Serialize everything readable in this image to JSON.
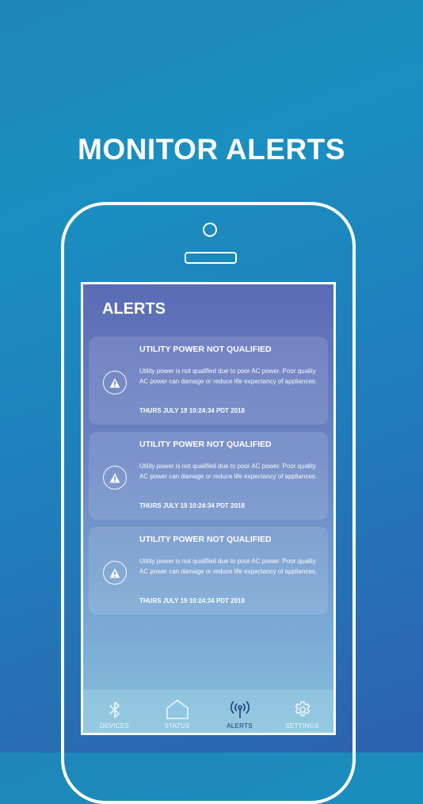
{
  "headline": "MONITOR ALERTS",
  "screen": {
    "title": "ALERTS"
  },
  "alerts": [
    {
      "title": "UTILITY POWER NOT QUALIFIED",
      "body": "Utility power is not qualified due to poor AC power. Poor quality AC power can damage or reduce life expectancy of appliances.",
      "timestamp": "THURS JULY 19 10:24:34 PDT 2018",
      "icon": "warning-icon"
    },
    {
      "title": "UTILITY POWER NOT QUALIFIED",
      "body": "Utility power is not qualified due to poor AC power. Poor quality AC power can damage or reduce life expectancy of appliances.",
      "timestamp": "THURS JULY 19 10:24:34 PDT 2018",
      "icon": "warning-icon"
    },
    {
      "title": "UTILITY POWER NOT QUALIFIED",
      "body": "Utility power is not qualified due to poor AC power. Poor quality AC power can damage or reduce life expectancy of appliances.",
      "timestamp": "THURS JULY 19 10:24:34 PDT 2018",
      "icon": "warning-icon"
    }
  ],
  "tabbar": {
    "items": [
      {
        "label": "DEVICES",
        "icon": "bluetooth-icon",
        "active": false
      },
      {
        "label": "STATUS",
        "icon": "house-icon",
        "active": false
      },
      {
        "label": "ALERTS",
        "icon": "antenna-icon",
        "active": true
      },
      {
        "label": "SETTINGS",
        "icon": "gear-icon",
        "active": false
      }
    ]
  },
  "colors": {
    "active_tab": "#1b3a7a",
    "inactive_tab": "#eef6fa",
    "frame": "#ffffff"
  }
}
